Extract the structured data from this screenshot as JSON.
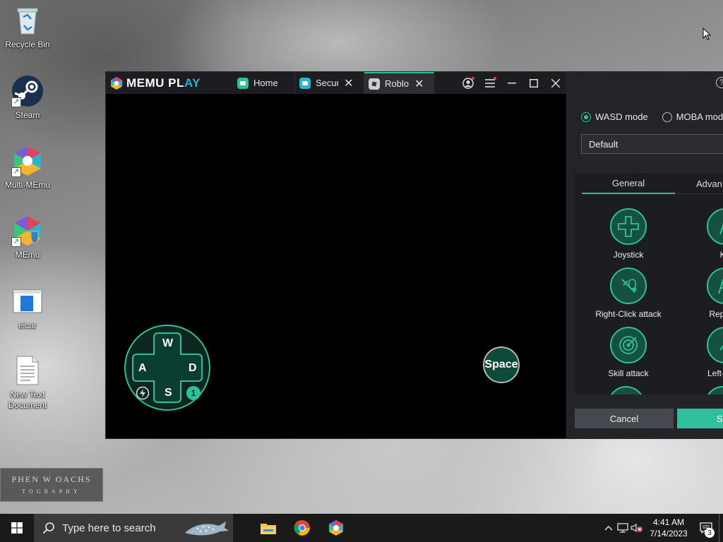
{
  "desktop": {
    "icons": [
      {
        "label": "Recycle Bin"
      },
      {
        "label": "Steam"
      },
      {
        "label": "Multi-MEmu"
      },
      {
        "label": "MEmu"
      },
      {
        "label": "eicar"
      },
      {
        "label": "New Text\nDocument"
      }
    ],
    "watermark": {
      "line1": "PHEN W OACHS",
      "line2": "TOGRAPHY"
    }
  },
  "memu": {
    "brand": "MEMU PLAY",
    "brand_main": "MEMU PL",
    "brand_accent": "AY",
    "tabs": [
      {
        "label": "Home",
        "active": false,
        "closable": false
      },
      {
        "label": "Securi",
        "active": false,
        "closable": true
      },
      {
        "label": "Roblox",
        "active": true,
        "closable": true
      }
    ],
    "window_controls": [
      "account-icon",
      "menu-icon",
      "minimize-icon",
      "maximize-icon",
      "close-icon"
    ],
    "overlay": {
      "dpad": {
        "up": "W",
        "left": "A",
        "right": "D",
        "down": "S",
        "badge": "1"
      },
      "space_key": "Space"
    }
  },
  "keymap_panel": {
    "help": "?",
    "modes": [
      {
        "label": "WASD mode",
        "selected": true
      },
      {
        "label": "MOBA mode",
        "selected": false
      }
    ],
    "preset": "Default",
    "tabs": [
      "General",
      "Advan"
    ],
    "tools": [
      {
        "label": "Joystick"
      },
      {
        "label": "Ke"
      },
      {
        "label": "Right-Click attack"
      },
      {
        "label": "Repeate"
      },
      {
        "label": "Skill attack"
      },
      {
        "label": "Left-Click"
      }
    ],
    "cancel_label": "Cancel",
    "save_label": "Sa"
  },
  "taskbar": {
    "search_placeholder": "Type here to search",
    "pinned": [
      "file-explorer-icon",
      "chrome-icon",
      "memu-icon"
    ],
    "clock_time": "4:41 AM",
    "clock_date": "7/14/2023",
    "notification_count": "3"
  },
  "colors": {
    "accent": "#2fbf9c",
    "titlebar": "#1c1d20",
    "panel": "#232428"
  }
}
